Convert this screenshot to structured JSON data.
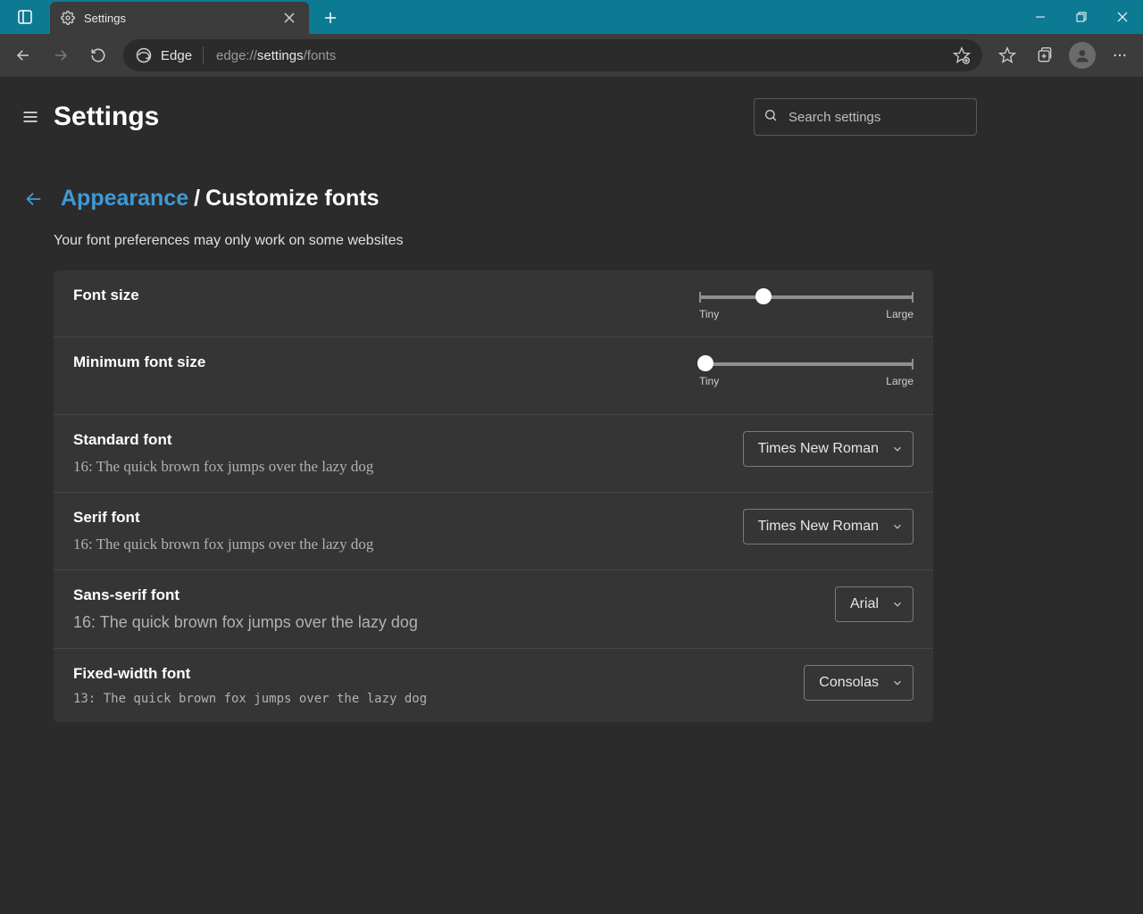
{
  "tab": {
    "title": "Settings"
  },
  "address": {
    "app_label": "Edge",
    "url_dim1": "edge://",
    "url_bright": "settings",
    "url_dim2": "/fonts"
  },
  "header": {
    "title": "Settings"
  },
  "search": {
    "placeholder": "Search settings"
  },
  "breadcrumb": {
    "parent": "Appearance",
    "separator": "/",
    "current": "Customize fonts"
  },
  "hint": "Your font preferences may only work on some websites",
  "sliders": {
    "font_size": {
      "label": "Font size",
      "min_label": "Tiny",
      "max_label": "Large",
      "value_percent": 30
    },
    "min_font_size": {
      "label": "Minimum font size",
      "min_label": "Tiny",
      "max_label": "Large",
      "value_percent": 3
    }
  },
  "fonts": {
    "standard": {
      "label": "Standard font",
      "value": "Times New Roman",
      "sample": "16: The quick brown fox jumps over the lazy dog"
    },
    "serif": {
      "label": "Serif font",
      "value": "Times New Roman",
      "sample": "16: The quick brown fox jumps over the lazy dog"
    },
    "sans": {
      "label": "Sans-serif font",
      "value": "Arial",
      "sample": "16: The quick brown fox jumps over the lazy dog"
    },
    "fixed": {
      "label": "Fixed-width font",
      "value": "Consolas",
      "sample": "13: The quick brown fox jumps over the lazy dog"
    }
  }
}
